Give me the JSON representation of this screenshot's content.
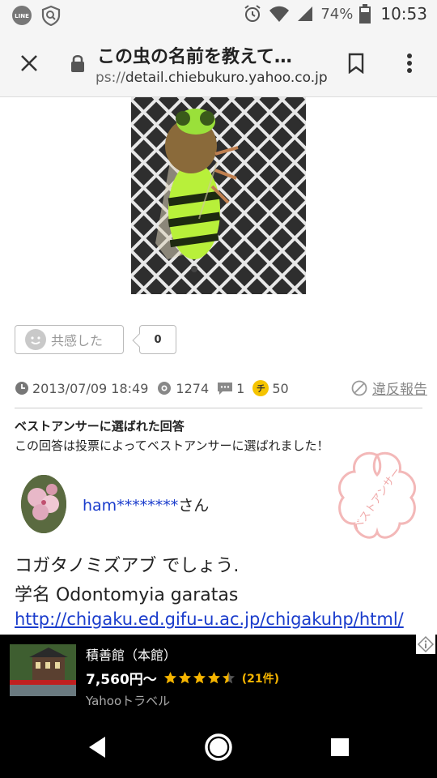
{
  "status_bar": {
    "battery_percent": "74%",
    "time": "10:53",
    "icons": [
      "line-icon",
      "shield-icon",
      "alarm-icon",
      "wifi-icon",
      "signal-icon",
      "battery-icon"
    ]
  },
  "toolbar": {
    "title": "この虫の名前を教えて…",
    "url_scheme": "ps://",
    "url_host": "detail.chiebukuro.yahoo.co.jp"
  },
  "reaction": {
    "empathy_label": "共感した",
    "empathy_count": "0"
  },
  "meta": {
    "date": "2013/07/09 18:49",
    "views": "1274",
    "comments": "1",
    "chie_badge": "チ",
    "chie_coins": "50",
    "report_label": "違反報告"
  },
  "best_answer": {
    "heading": "ベストアンサーに選ばれた回答",
    "description": "この回答は投票によってベストアンサーに選ばれました！",
    "user_name": "ham********",
    "user_suffix": "さん",
    "stamp_text": "ベストアンサー",
    "line1": "コガタノミズアブ でしょう.",
    "line2": "学名 Odontomyia garatas",
    "link": "http://chigaku.ed.gifu-u.ac.jp/chigakuhp/html/"
  },
  "ad": {
    "title": "積善館（本館）",
    "price": "7,560円〜",
    "rating": 4.5,
    "reviews": "(21件)",
    "source": "Yahooトラベル"
  },
  "colors": {
    "link_blue": "#1a3ccc",
    "stamp_pink": "#f3b8b8",
    "star_gold": "#f5b400"
  }
}
